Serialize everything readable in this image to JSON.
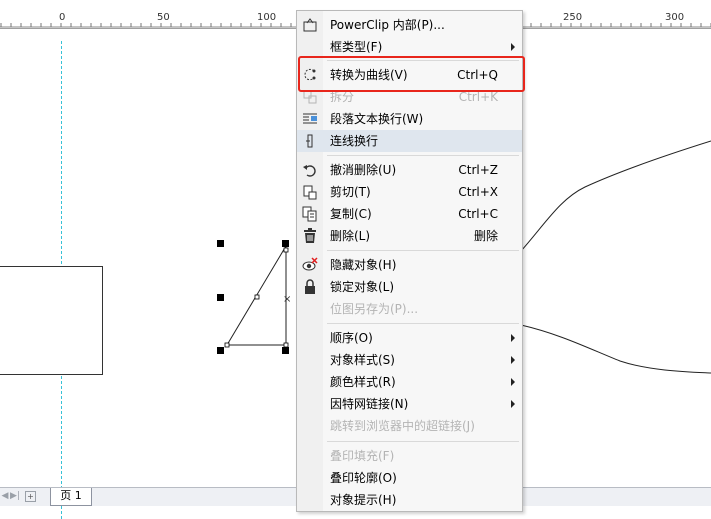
{
  "ruler": {
    "ticks": [
      "0",
      "50",
      "100",
      "250",
      "300"
    ]
  },
  "page_tab": {
    "label": "页 1"
  },
  "context_menu": {
    "items": [
      {
        "label": "PowerClip 内部(P)...",
        "shortcut": "",
        "icon": "powerclip-icon"
      },
      {
        "label": "框类型(F)",
        "shortcut": "",
        "icon": ""
      },
      {
        "label": "转换为曲线(V)",
        "shortcut": "Ctrl+Q",
        "icon": "convert-to-curves-icon"
      },
      {
        "label": "拆分",
        "shortcut": "Ctrl+K",
        "icon": "break-apart-icon"
      },
      {
        "label": "段落文本换行(W)",
        "shortcut": "",
        "icon": "text-wrap-icon"
      },
      {
        "label": "连线换行",
        "shortcut": "",
        "icon": "connector-wrap-icon"
      },
      {
        "label": "撤消删除(U)",
        "shortcut": "Ctrl+Z",
        "icon": "undo-icon"
      },
      {
        "label": "剪切(T)",
        "shortcut": "Ctrl+X",
        "icon": "cut-icon"
      },
      {
        "label": "复制(C)",
        "shortcut": "Ctrl+C",
        "icon": "copy-icon"
      },
      {
        "label": "删除(L)",
        "shortcut": "删除",
        "icon": "trash-icon"
      },
      {
        "label": "隐藏对象(H)",
        "shortcut": "",
        "icon": "hide-object-icon"
      },
      {
        "label": "锁定对象(L)",
        "shortcut": "",
        "icon": "lock-icon"
      },
      {
        "label": "位图另存为(P)...",
        "shortcut": "",
        "icon": ""
      },
      {
        "label": "顺序(O)",
        "shortcut": "",
        "icon": ""
      },
      {
        "label": "对象样式(S)",
        "shortcut": "",
        "icon": ""
      },
      {
        "label": "颜色样式(R)",
        "shortcut": "",
        "icon": ""
      },
      {
        "label": "因特网链接(N)",
        "shortcut": "",
        "icon": ""
      },
      {
        "label": "跳转到浏览器中的超链接(J)",
        "shortcut": "",
        "icon": ""
      },
      {
        "label": "叠印填充(F)",
        "shortcut": "",
        "icon": ""
      },
      {
        "label": "叠印轮廓(O)",
        "shortcut": "",
        "icon": ""
      },
      {
        "label": "对象提示(H)",
        "shortcut": "",
        "icon": ""
      }
    ]
  },
  "colors": {
    "guide": "#36c0d6",
    "highlight_border": "#e8261c",
    "disabled_text": "#b4b4b4"
  }
}
